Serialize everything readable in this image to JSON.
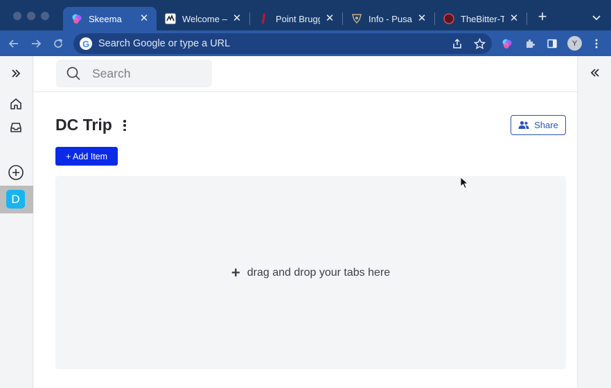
{
  "browser": {
    "tabs": [
      {
        "title": "Skeema",
        "active": true,
        "favicon": "skeema-logo-icon"
      },
      {
        "title": "Welcome —",
        "active": false,
        "favicon": "welcome-favicon-icon"
      },
      {
        "title": "Point Brugg",
        "active": false,
        "favicon": "point-bruggen-favicon-icon"
      },
      {
        "title": "Info - Pusad",
        "active": false,
        "favicon": "pusad-favicon-icon"
      },
      {
        "title": "TheBitter-Ti",
        "active": false,
        "favicon": "thebitter-favicon-icon"
      }
    ],
    "new_tab_label": "+",
    "omnibox": {
      "placeholder": "Search Google or type a URL"
    },
    "profile_initial": "Y"
  },
  "sidebar": {
    "space_badge": "D"
  },
  "search": {
    "placeholder": "Search"
  },
  "page": {
    "title": "DC Trip",
    "share_label": "Share",
    "add_item_label": "+ Add Item",
    "dropzone_text": "drag and drop your tabs here",
    "dropzone_plus": "+"
  },
  "colors": {
    "browser_tabbar": "#183a6b",
    "browser_toolbar": "#2b5ba8",
    "primary_button": "#0b2ae8",
    "share_outline": "#2a53b8",
    "space_badge": "#18b4f0"
  }
}
